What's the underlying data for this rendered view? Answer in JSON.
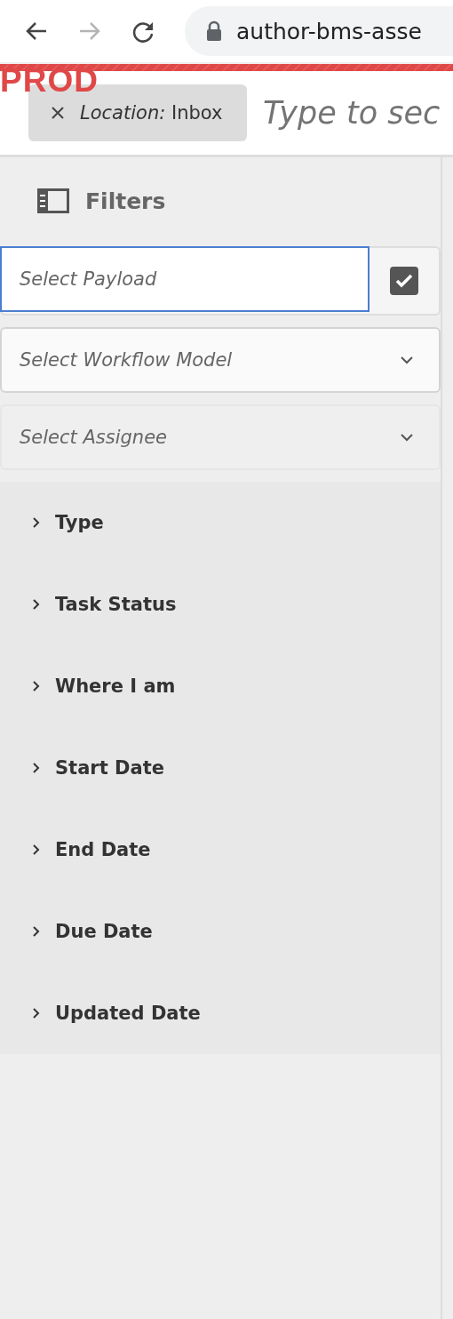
{
  "browser": {
    "url": "author-bms-asse",
    "forward_disabled": true
  },
  "environment_badge": "PROD",
  "search": {
    "tag_label": "Location:",
    "tag_value": "Inbox",
    "placeholder": "Type to sec"
  },
  "filters": {
    "title": "Filters",
    "payload": {
      "placeholder": "Select Payload",
      "focused": true,
      "checked": true
    },
    "dropdowns": [
      {
        "placeholder": "Select Workflow Model",
        "disabled": false
      },
      {
        "placeholder": "Select Assignee",
        "disabled": true
      }
    ],
    "sections": [
      {
        "label": "Type",
        "expanded": false
      },
      {
        "label": "Task Status",
        "expanded": false
      },
      {
        "label": "Where I am",
        "expanded": false
      },
      {
        "label": "Start Date",
        "expanded": false
      },
      {
        "label": "End Date",
        "expanded": false
      },
      {
        "label": "Due Date",
        "expanded": false
      },
      {
        "label": "Updated Date",
        "expanded": false
      }
    ]
  }
}
